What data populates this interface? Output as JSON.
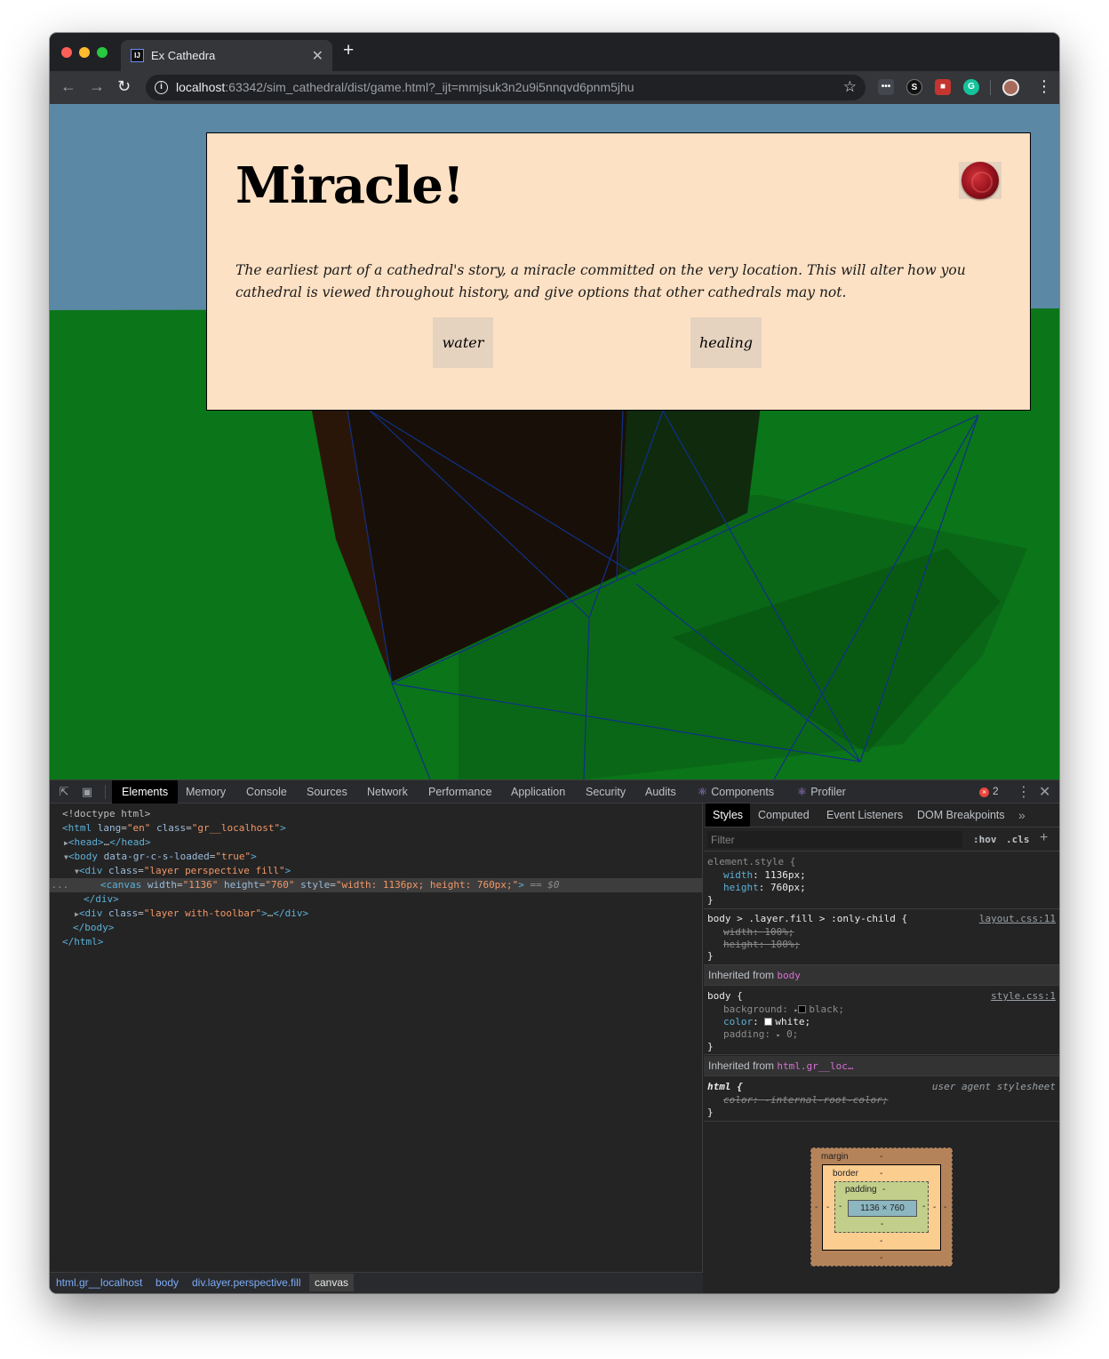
{
  "browser": {
    "tab_title": "Ex Cathedra",
    "tab_favicon_text": "IJ",
    "close_symbol": "✕",
    "new_tab_symbol": "+",
    "url_host": "localhost",
    "url_rest": ":63342/sim_cathedral/dist/game.html?_ijt=mmjsuk3n2u9i5nnqvd6pnm5jhu",
    "icons": [
      "back-arrow-icon",
      "forward-arrow-icon",
      "reload-icon",
      "info-icon",
      "star-icon",
      "extension-icons",
      "avatar",
      "menu-icon"
    ]
  },
  "game": {
    "modal": {
      "title": "Miracle!",
      "description": "The earliest part of a cathedral's story, a miracle committed on the very location. This will alter how you cathedral is viewed throughout history, and give options that other cathedrals may not.",
      "choices": [
        "water",
        "healing"
      ],
      "close_icon": "wax-seal-icon"
    },
    "colors": {
      "sky": "#5b88a5",
      "ground": "#0b7519",
      "modal_bg": "#fde1c4",
      "choice_bg": "#e5d2bf"
    }
  },
  "devtools": {
    "tabs": [
      "Elements",
      "Memory",
      "Console",
      "Sources",
      "Network",
      "Performance",
      "Application",
      "Security",
      "Audits",
      "Components",
      "Profiler"
    ],
    "active_tab": "Elements",
    "error_count": "2",
    "dom": {
      "doctype": "<!doctype html>",
      "html_tag": "html",
      "html_lang_attr": "lang",
      "html_lang": "en",
      "html_class_attr": "class",
      "html_class": "gr__localhost",
      "head": "head",
      "head_ellipsis": "…",
      "body_tag": "body",
      "body_attr": "data-gr-c-s-loaded",
      "body_attr_val": "true",
      "div_tag": "div",
      "div_class_attr": "class",
      "div_class": "layer perspective fill",
      "canvas_tag": "canvas",
      "canvas_width_attr": "width",
      "canvas_width": "1136",
      "canvas_height_attr": "height",
      "canvas_height": "760",
      "canvas_style_attr": "style",
      "canvas_style": "width: 1136px; height: 760px;",
      "selected_marker": "== $0",
      "dots": "...",
      "div2_class": "layer with-toolbar",
      "div2_ellipsis": "…"
    },
    "breadcrumbs": [
      "html.gr__localhost",
      "body",
      "div.layer.perspective.fill",
      "canvas"
    ],
    "styles": {
      "tabs": [
        "Styles",
        "Computed",
        "Event Listeners",
        "DOM Breakpoints"
      ],
      "active_tab": "Styles",
      "filter_placeholder": "Filter",
      "hov": ":hov",
      "cls": ".cls",
      "rule1_selector": "element.style {",
      "rule1_props": [
        {
          "name": "width",
          "value": "1136px;"
        },
        {
          "name": "height",
          "value": "760px;"
        }
      ],
      "close_brace": "}",
      "rule2_selector": "body > .layer.fill > :only-child {",
      "rule2_source": "layout.css:11",
      "rule2_props": [
        {
          "name": "width",
          "value": "100%;"
        },
        {
          "name": "height",
          "value": "100%;"
        }
      ],
      "inherited_label": "Inherited from",
      "inherited1": "body",
      "rule3_selector": "body {",
      "rule3_source": "style.css:1",
      "rule3_props": [
        {
          "name": "background",
          "value": "black;"
        },
        {
          "name": "color",
          "value": "white;"
        },
        {
          "name": "padding",
          "value": "0;"
        }
      ],
      "inherited2": "html.gr__loc…",
      "rule4_selector": "html {",
      "rule4_source": "user agent stylesheet",
      "rule4_props": [
        {
          "name": "color",
          "value": "-internal-root-color;"
        }
      ],
      "boxmodel": {
        "margin": "margin",
        "border": "border",
        "padding": "padding",
        "dash": "-",
        "content": "1136 × 760"
      }
    }
  }
}
